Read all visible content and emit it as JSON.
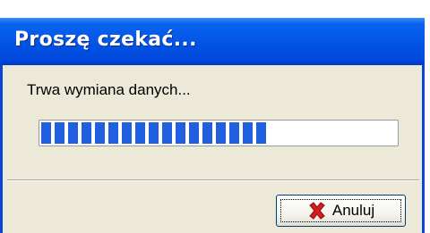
{
  "window": {
    "title": "Proszę czekać..."
  },
  "message": "Trwa wymiana danych...",
  "progress": {
    "fraction": 0.66
  },
  "buttons": {
    "cancel_label": "Anuluj",
    "cancel_icon": "red-x-icon"
  },
  "colors": {
    "titlebar": "#0455e6",
    "progress_fill": "#2060e0",
    "dialog_bg": "#ece9d8",
    "cancel_icon": "#d21e1e"
  }
}
